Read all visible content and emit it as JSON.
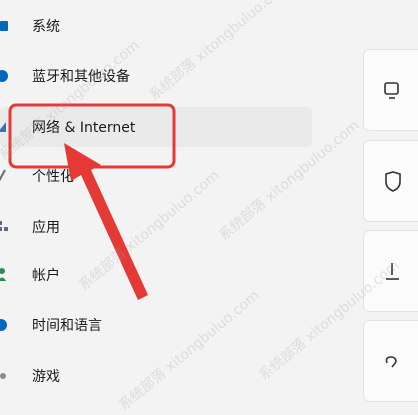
{
  "nav": {
    "items": [
      {
        "label": "系统",
        "icon": "system-icon",
        "selected": false
      },
      {
        "label": "蓝牙和其他设备",
        "icon": "bluetooth-icon",
        "selected": false
      },
      {
        "label": "网络 & Internet",
        "icon": "network-icon",
        "selected": true
      },
      {
        "label": "个性化",
        "icon": "personalization-icon",
        "selected": false
      },
      {
        "label": "应用",
        "icon": "apps-icon",
        "selected": false
      },
      {
        "label": "帐户",
        "icon": "accounts-icon",
        "selected": false
      },
      {
        "label": "时间和语言",
        "icon": "time-language-icon",
        "selected": false
      },
      {
        "label": "游戏",
        "icon": "gaming-icon",
        "selected": false
      }
    ]
  },
  "watermark": {
    "text": "系统部落 xitongbuluo.com"
  },
  "colors": {
    "accent": "#0067c0",
    "highlight_box": "#e53935",
    "arrow": "#e53935",
    "selected_bg": "#eaeaea"
  }
}
